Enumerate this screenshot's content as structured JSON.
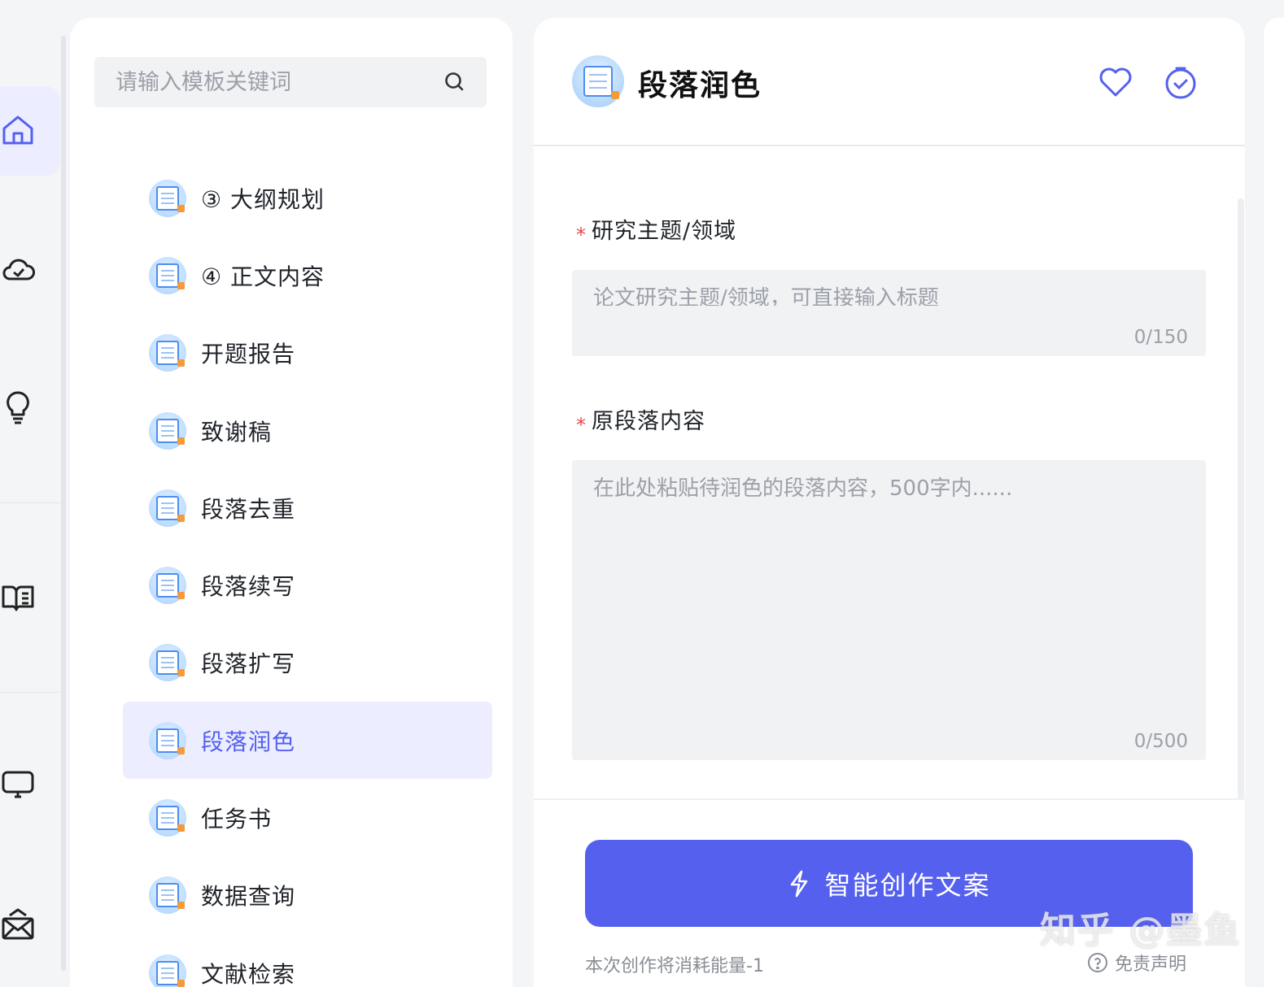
{
  "rail": {
    "items": [
      {
        "icon": "home-icon",
        "active": true
      },
      {
        "icon": "cloud-check-icon"
      },
      {
        "icon": "lightbulb-icon"
      },
      {
        "icon": "book-icon"
      },
      {
        "icon": "monitor-icon"
      },
      {
        "icon": "mail-icon"
      }
    ]
  },
  "search": {
    "placeholder": "请输入模板关键词"
  },
  "templates": [
    {
      "label": "③ 大纲规划"
    },
    {
      "label": "④ 正文内容"
    },
    {
      "label": "开题报告"
    },
    {
      "label": "致谢稿"
    },
    {
      "label": "段落去重"
    },
    {
      "label": "段落续写"
    },
    {
      "label": "段落扩写"
    },
    {
      "label": "段落润色",
      "active": true
    },
    {
      "label": "任务书"
    },
    {
      "label": "数据查询"
    },
    {
      "label": "文献检索"
    }
  ],
  "form": {
    "title": "段落润色",
    "field1": {
      "required_mark": "*",
      "label": "研究主题/领域",
      "placeholder": "论文研究主题/领域，可直接输入标题",
      "count": "0/150"
    },
    "field2": {
      "required_mark": "*",
      "label": "原段落内容",
      "placeholder": "在此处粘贴待润色的段落内容，500字内......",
      "count": "0/500"
    },
    "submit_label": "智能创作文案",
    "cost_note": "本次创作将消耗能量-1",
    "disclaimer": "免责声明"
  },
  "watermark": "知乎 @墨鱼",
  "colors": {
    "accent": "#5560ee",
    "active_bg": "#eceeff",
    "required": "#e5484d"
  }
}
